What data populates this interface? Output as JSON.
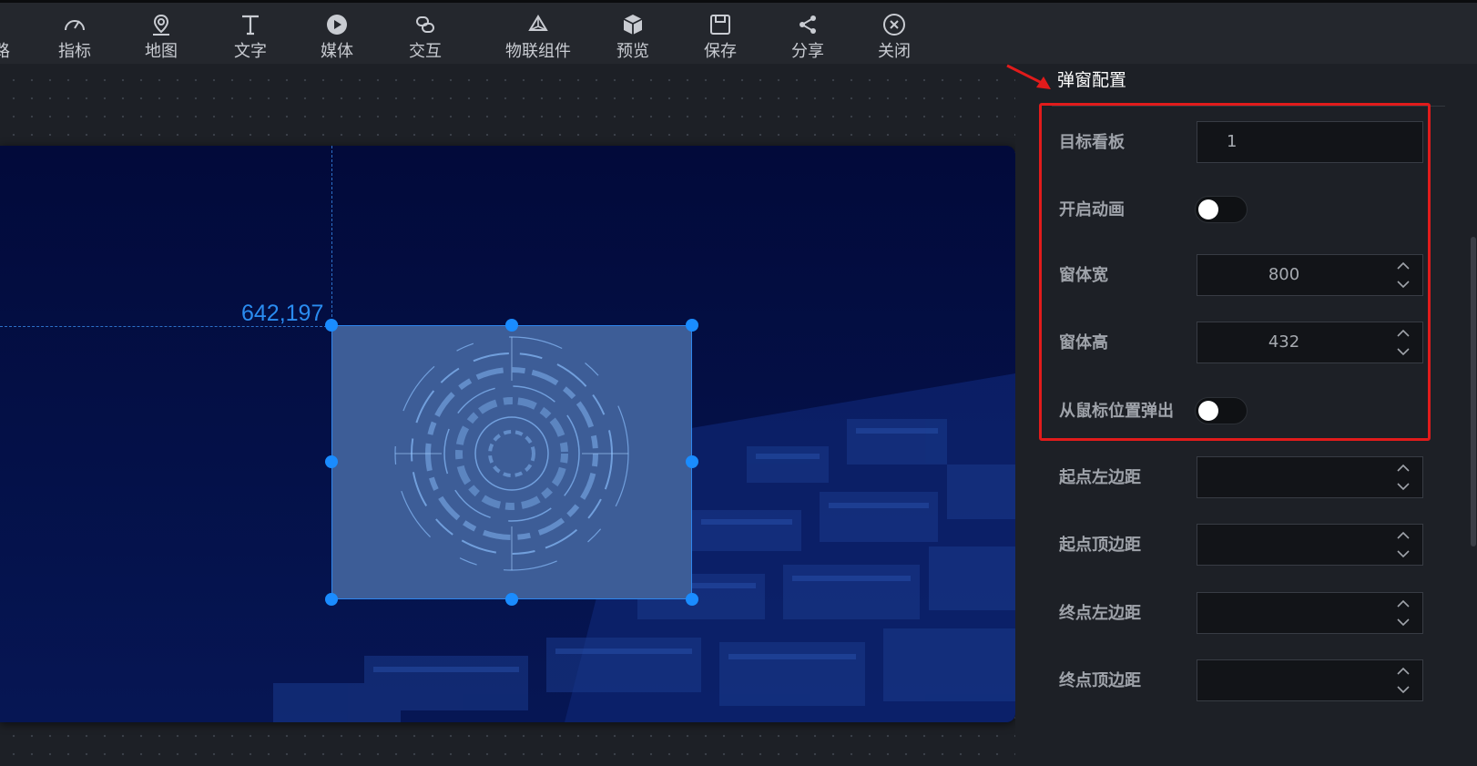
{
  "toolbar": {
    "items": [
      {
        "label": "路",
        "icon": "route-icon"
      },
      {
        "label": "指标",
        "icon": "gauge-icon"
      },
      {
        "label": "地图",
        "icon": "map-pin-icon"
      },
      {
        "label": "文字",
        "icon": "text-icon"
      },
      {
        "label": "媒体",
        "icon": "play-circle-icon"
      },
      {
        "label": "交互",
        "icon": "link-icon"
      },
      {
        "label": "物联组件",
        "icon": "iot-icon"
      },
      {
        "label": "预览",
        "icon": "cube-icon"
      },
      {
        "label": "保存",
        "icon": "save-icon"
      },
      {
        "label": "分享",
        "icon": "share-icon"
      },
      {
        "label": "关闭",
        "icon": "close-circle-icon"
      }
    ]
  },
  "canvas": {
    "coordinates": "642,197"
  },
  "panel": {
    "title": "弹窗配置",
    "fields": {
      "target_board": {
        "label": "目标看板",
        "value": "1"
      },
      "enable_animation": {
        "label": "开启动画",
        "on": false
      },
      "window_width": {
        "label": "窗体宽",
        "value": "800"
      },
      "window_height": {
        "label": "窗体高",
        "value": "432"
      },
      "popup_from_mouse": {
        "label": "从鼠标位置弹出",
        "on": false
      },
      "start_left": {
        "label": "起点左边距",
        "value": ""
      },
      "start_top": {
        "label": "起点顶边距",
        "value": ""
      },
      "end_left": {
        "label": "终点左边距",
        "value": ""
      },
      "end_top": {
        "label": "终点顶边距",
        "value": ""
      }
    }
  },
  "colors": {
    "accent": "#1a8cff",
    "highlight_box": "#e11b1b",
    "panel_bg": "#1d2026",
    "screen_bg": "#020a3a"
  }
}
